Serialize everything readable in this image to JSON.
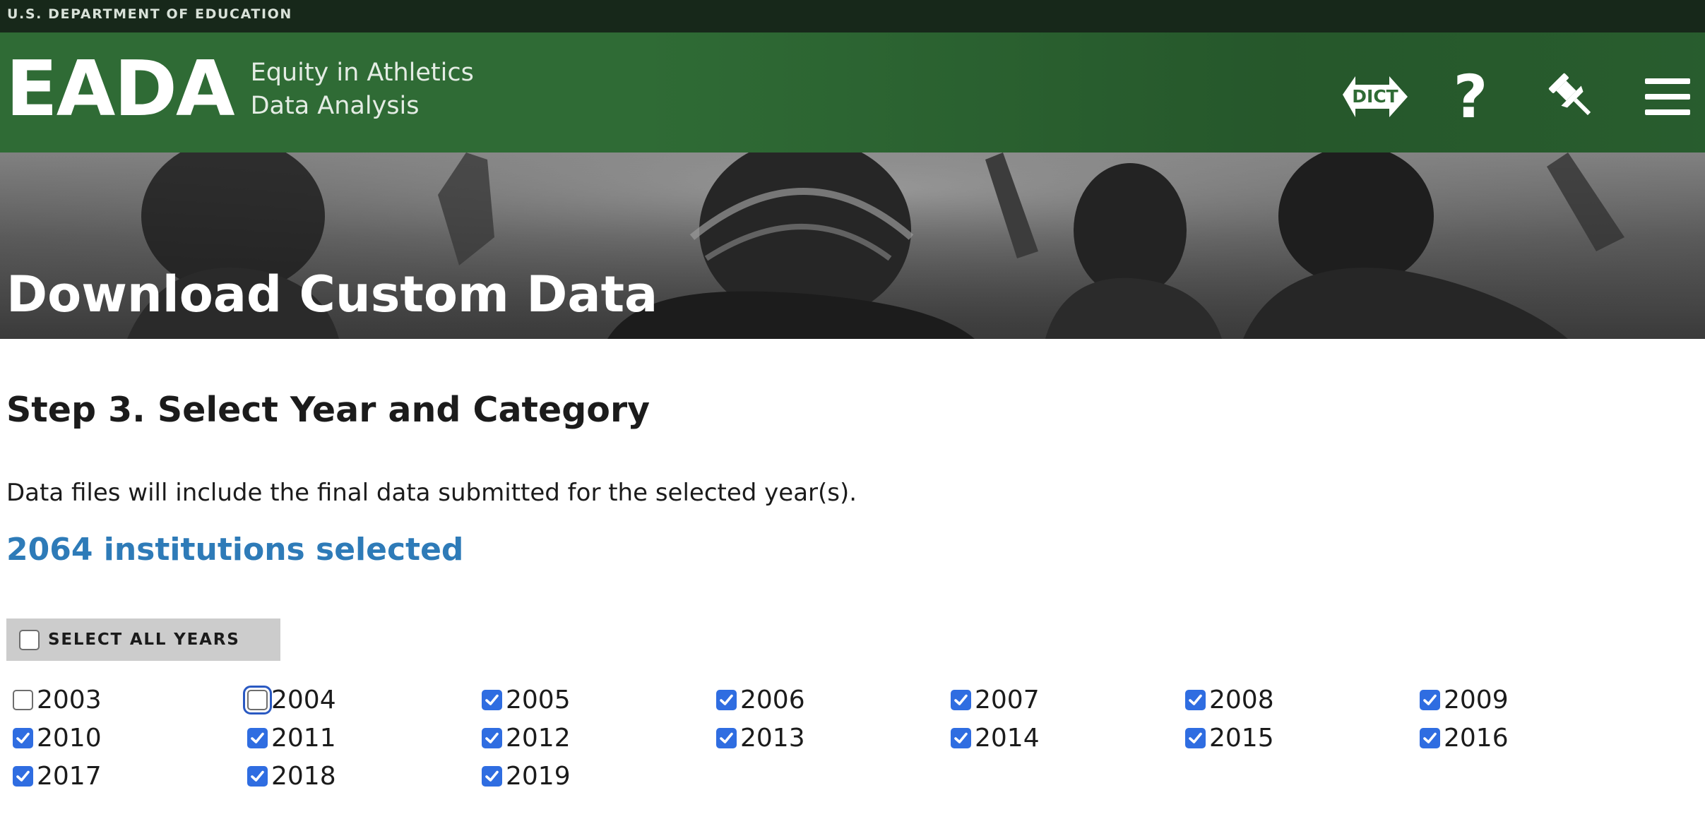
{
  "gov_bar": {
    "text": "U.S. DEPARTMENT OF EDUCATION"
  },
  "header": {
    "logo": "EADA",
    "logo_line1": "Equity in Athletics",
    "logo_line2": "Data Analysis",
    "icons": [
      "dictionary-icon",
      "help-icon",
      "pin-icon",
      "menu-icon"
    ],
    "dict_label": "DICT",
    "help_glyph": "?",
    "accent_color": "#2f6b35"
  },
  "hero": {
    "title": "Download Custom Data"
  },
  "main": {
    "step_title": "Step 3. Select Year and Category",
    "description": "Data files will include the final data submitted for the selected year(s).",
    "institutions_selected": "2064 institutions selected",
    "count_color": "#2e7bb8",
    "select_all": {
      "label": "SELECT ALL YEARS",
      "checked": false
    },
    "years": [
      {
        "label": "2003",
        "checked": false
      },
      {
        "label": "2004",
        "checked": false,
        "focused": true
      },
      {
        "label": "2005",
        "checked": true
      },
      {
        "label": "2006",
        "checked": true
      },
      {
        "label": "2007",
        "checked": true
      },
      {
        "label": "2008",
        "checked": true
      },
      {
        "label": "2009",
        "checked": true
      },
      {
        "label": "2010",
        "checked": true
      },
      {
        "label": "2011",
        "checked": true
      },
      {
        "label": "2012",
        "checked": true
      },
      {
        "label": "2013",
        "checked": true
      },
      {
        "label": "2014",
        "checked": true
      },
      {
        "label": "2015",
        "checked": true
      },
      {
        "label": "2016",
        "checked": true
      },
      {
        "label": "2017",
        "checked": true
      },
      {
        "label": "2018",
        "checked": true
      },
      {
        "label": "2019",
        "checked": true
      }
    ]
  }
}
